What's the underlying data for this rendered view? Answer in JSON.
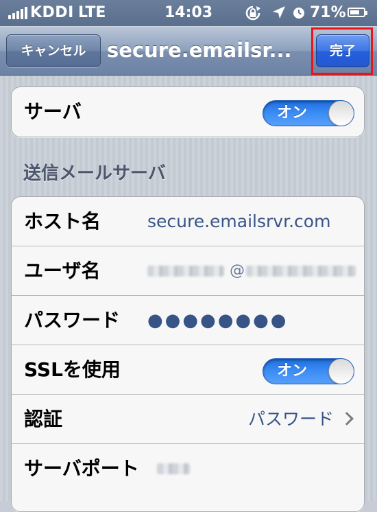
{
  "status_bar": {
    "carrier": "KDDI",
    "network": "LTE",
    "time": "14:03",
    "battery_percent": "71%",
    "battery_level": 0.71,
    "icons": [
      "signal-bars-icon",
      "rotation-lock-icon",
      "location-arrow-icon",
      "alarm-clock-icon",
      "battery-icon"
    ]
  },
  "nav": {
    "cancel_label": "キャンセル",
    "title": "secure.emailsr...",
    "done_label": "完了",
    "highlight_color": "#e8151b"
  },
  "server_group": {
    "label": "サーバ",
    "toggle_label": "オン",
    "toggle_on": true
  },
  "section": {
    "header": "送信メールサーバ"
  },
  "rows": {
    "host": {
      "label": "ホスト名",
      "value": "secure.emailsrvr.com"
    },
    "user": {
      "label": "ユーザ名",
      "value_visible": "@"
    },
    "password": {
      "label": "パスワード",
      "value": "●●●●●●●●"
    },
    "ssl": {
      "label": "SSLを使用",
      "toggle_label": "オン",
      "toggle_on": true
    },
    "auth": {
      "label": "認証",
      "value": "パスワード"
    },
    "port": {
      "label": "サーバポート"
    }
  },
  "colors": {
    "accent_blue": "#2560dd",
    "value_text": "#385487",
    "toggle_on": "#3b8df5"
  }
}
